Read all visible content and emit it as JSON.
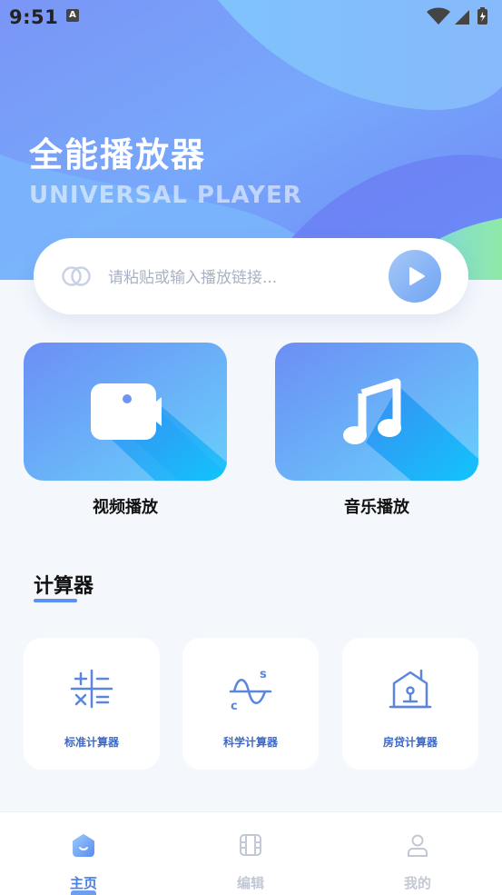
{
  "status_bar": {
    "time": "9:51",
    "notification_letter": "A"
  },
  "header": {
    "title": "全能播放器",
    "subtitle": "UNIVERSAL PLAYER"
  },
  "search": {
    "placeholder": "请粘贴或输入播放链接...",
    "value": ""
  },
  "media": [
    {
      "label": "视频播放",
      "icon": "video-camera-icon"
    },
    {
      "label": "音乐播放",
      "icon": "music-note-icon"
    }
  ],
  "calculator_section": {
    "title": "计算器",
    "items": [
      {
        "label": "标准计算器",
        "icon": "standard-calculator-icon"
      },
      {
        "label": "科学计算器",
        "icon": "scientific-calculator-icon"
      },
      {
        "label": "房贷计算器",
        "icon": "house-loan-icon"
      }
    ]
  },
  "bottom_nav": {
    "items": [
      {
        "label": "主页",
        "icon": "home-icon",
        "active": true
      },
      {
        "label": "编辑",
        "icon": "film-icon",
        "active": false
      },
      {
        "label": "我的",
        "icon": "user-icon",
        "active": false
      }
    ]
  },
  "colors": {
    "accent": "#4a7fe6",
    "hero_gradient_start": "#6f8ff5",
    "hero_gradient_end": "#8be5b5",
    "background": "#f4f7fc"
  }
}
